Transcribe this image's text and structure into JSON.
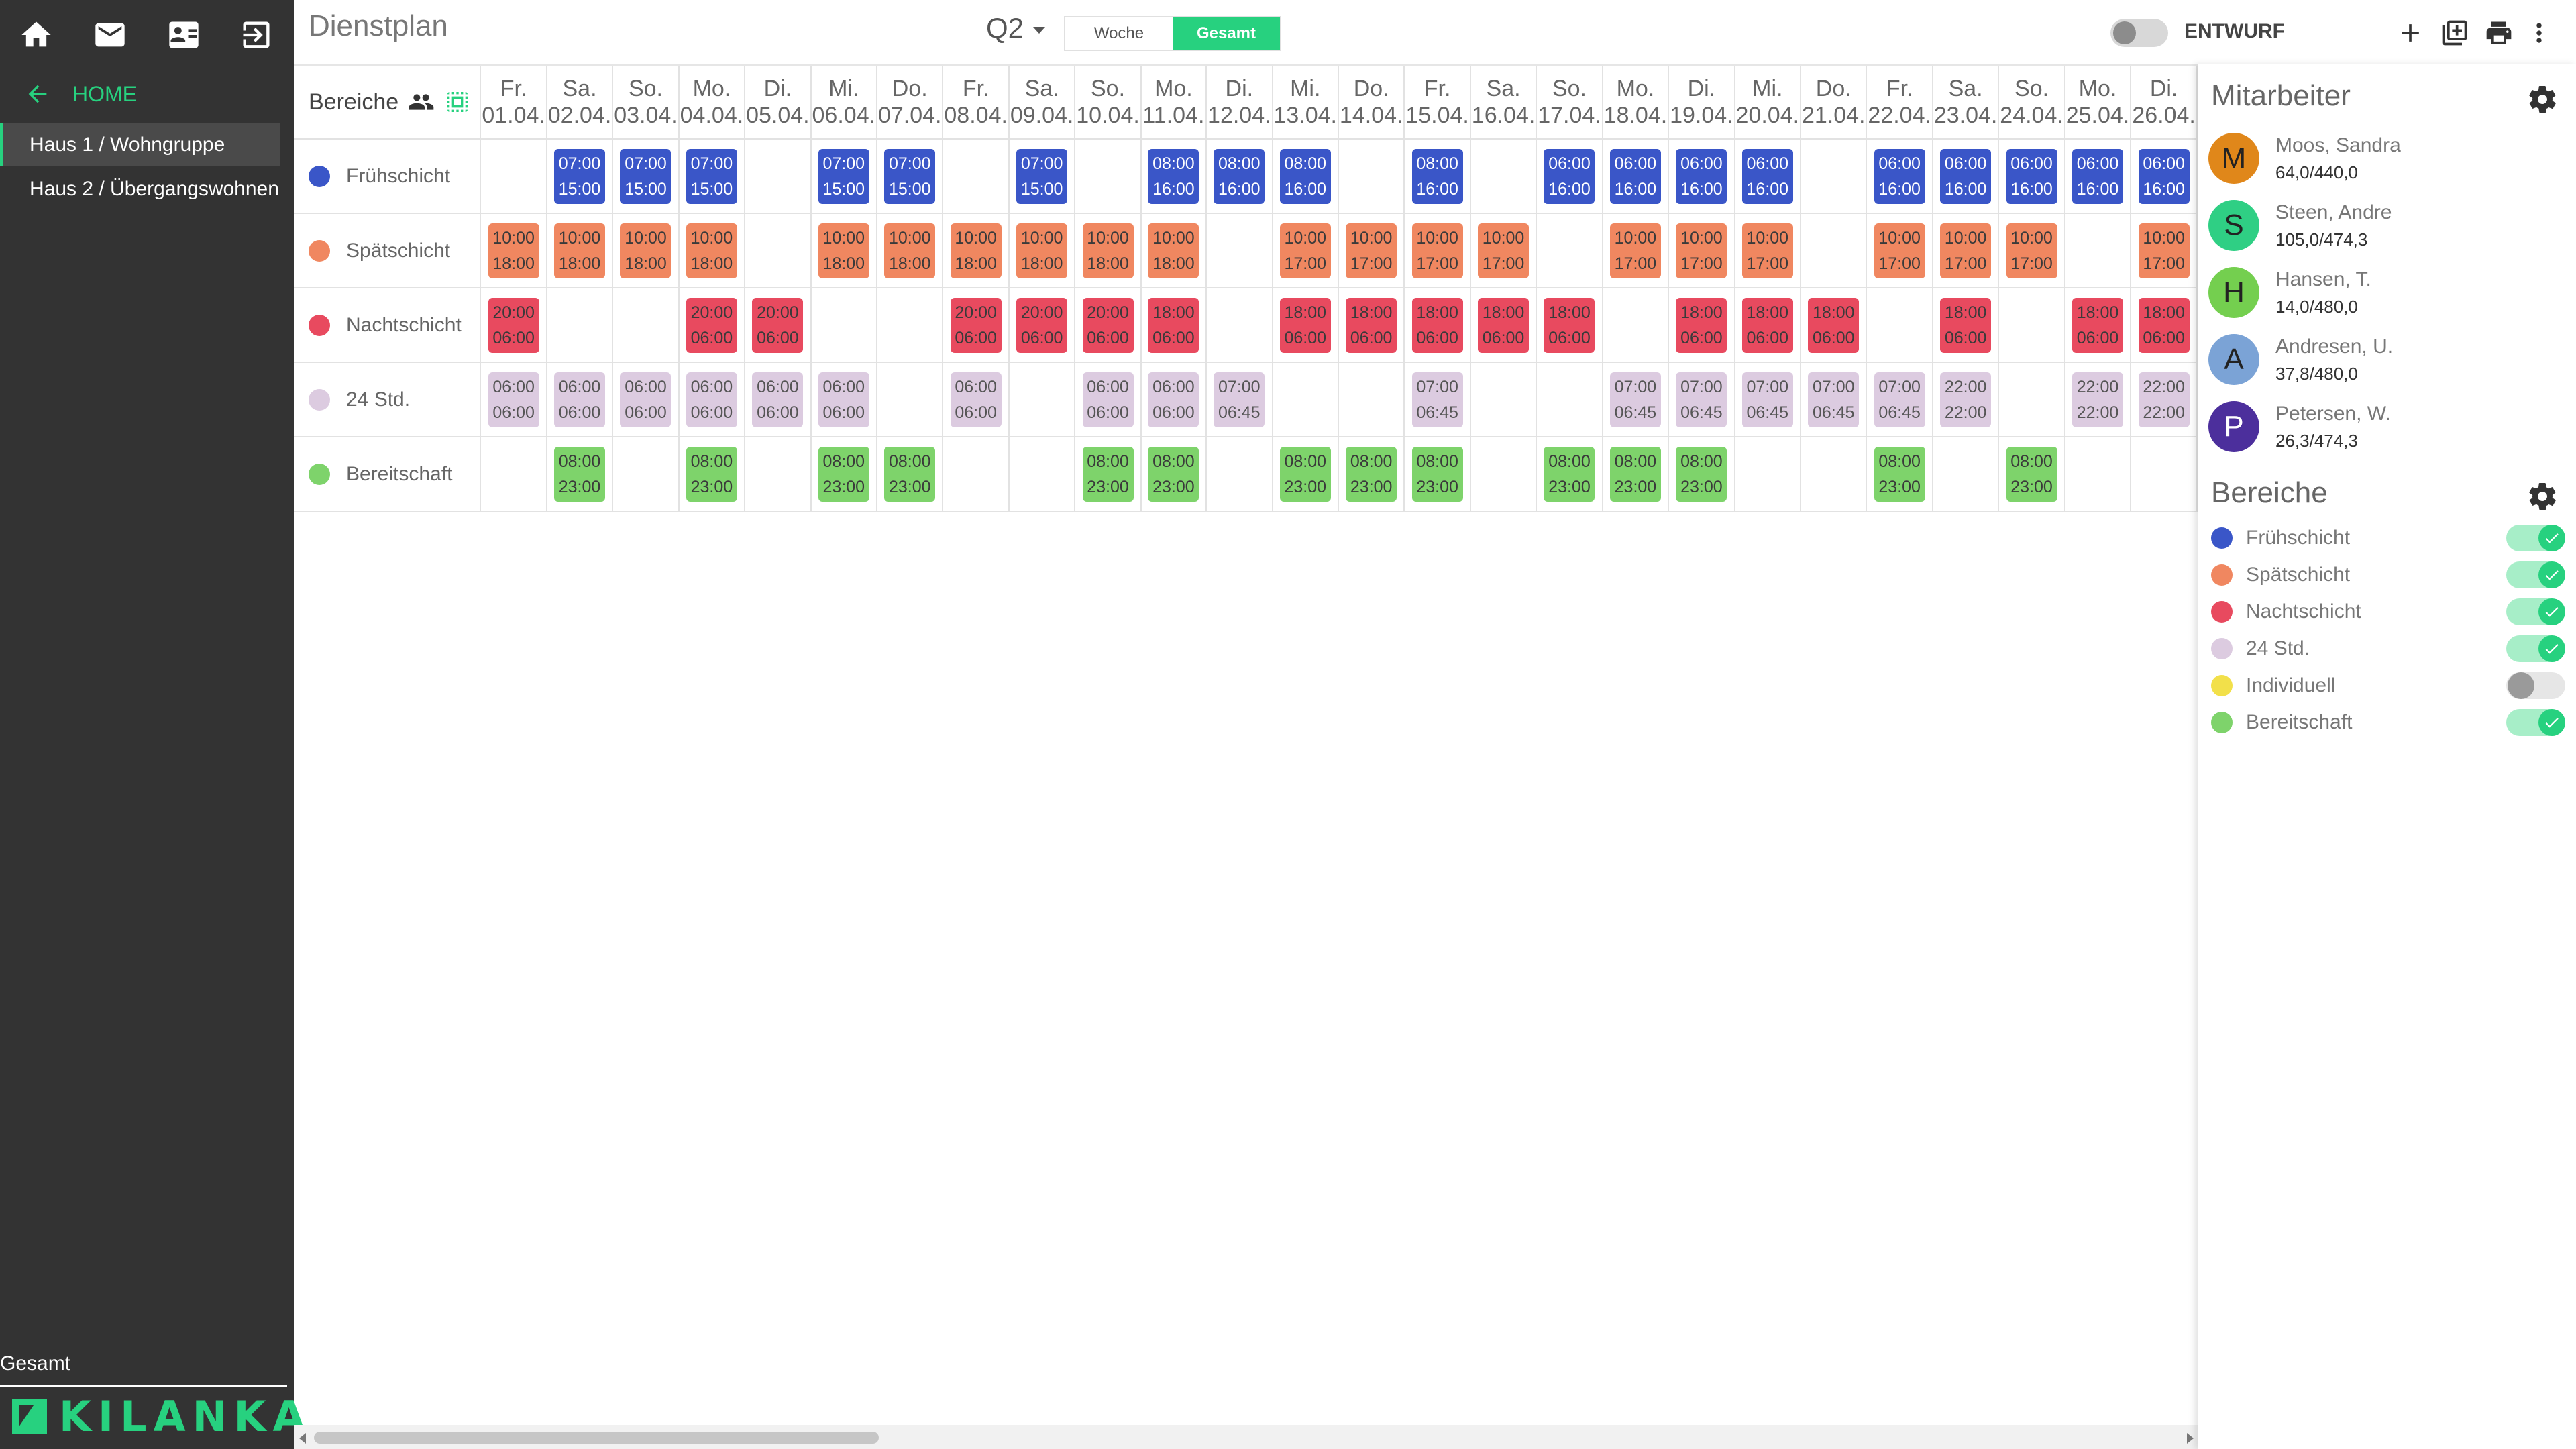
{
  "sidebar": {
    "home_label": "HOME",
    "nav": [
      "Haus 1 / Wohngruppe",
      "Haus 2 / Übergangswohnen"
    ],
    "footer_label": "Gesamt",
    "brand": "KILANKA"
  },
  "topbar": {
    "title": "Dienstplan",
    "quarter": "Q2",
    "view_week": "Woche",
    "view_all": "Gesamt",
    "draft_label": "ENTWURF"
  },
  "grid": {
    "corner_label": "Bereiche",
    "days": [
      [
        "Fr.",
        "01.04."
      ],
      [
        "Sa.",
        "02.04."
      ],
      [
        "So.",
        "03.04."
      ],
      [
        "Mo.",
        "04.04."
      ],
      [
        "Di.",
        "05.04."
      ],
      [
        "Mi.",
        "06.04."
      ],
      [
        "Do.",
        "07.04."
      ],
      [
        "Fr.",
        "08.04."
      ],
      [
        "Sa.",
        "09.04."
      ],
      [
        "So.",
        "10.04."
      ],
      [
        "Mo.",
        "11.04."
      ],
      [
        "Di.",
        "12.04."
      ],
      [
        "Mi.",
        "13.04."
      ],
      [
        "Do.",
        "14.04."
      ],
      [
        "Fr.",
        "15.04."
      ],
      [
        "Sa.",
        "16.04."
      ],
      [
        "So.",
        "17.04."
      ],
      [
        "Mo.",
        "18.04."
      ],
      [
        "Di.",
        "19.04."
      ],
      [
        "Mi.",
        "20.04."
      ],
      [
        "Do.",
        "21.04."
      ],
      [
        "Fr.",
        "22.04."
      ],
      [
        "Sa.",
        "23.04."
      ],
      [
        "So.",
        "24.04."
      ],
      [
        "Mo.",
        "25.04."
      ],
      [
        "Di.",
        "26.04."
      ]
    ],
    "rows": [
      {
        "name": "Frühschicht",
        "color": "#3a56c8",
        "bg": "#3a56c8",
        "fg": "#ffffff",
        "cells": [
          null,
          [
            "07:00",
            "15:00"
          ],
          [
            "07:00",
            "15:00"
          ],
          [
            "07:00",
            "15:00"
          ],
          null,
          [
            "07:00",
            "15:00"
          ],
          [
            "07:00",
            "15:00"
          ],
          null,
          [
            "07:00",
            "15:00"
          ],
          null,
          [
            "08:00",
            "16:00"
          ],
          [
            "08:00",
            "16:00"
          ],
          [
            "08:00",
            "16:00"
          ],
          null,
          [
            "08:00",
            "16:00"
          ],
          null,
          [
            "06:00",
            "16:00"
          ],
          [
            "06:00",
            "16:00"
          ],
          [
            "06:00",
            "16:00"
          ],
          [
            "06:00",
            "16:00"
          ],
          null,
          [
            "06:00",
            "16:00"
          ],
          [
            "06:00",
            "16:00"
          ],
          [
            "06:00",
            "16:00"
          ],
          [
            "06:00",
            "16:00"
          ],
          [
            "06:00",
            "16:00"
          ]
        ]
      },
      {
        "name": "Spätschicht",
        "color": "#f08760",
        "bg": "#f08760",
        "fg": "#3a3a3a",
        "cells": [
          [
            "10:00",
            "18:00"
          ],
          [
            "10:00",
            "18:00"
          ],
          [
            "10:00",
            "18:00"
          ],
          [
            "10:00",
            "18:00"
          ],
          null,
          [
            "10:00",
            "18:00"
          ],
          [
            "10:00",
            "18:00"
          ],
          [
            "10:00",
            "18:00"
          ],
          [
            "10:00",
            "18:00"
          ],
          [
            "10:00",
            "18:00"
          ],
          [
            "10:00",
            "18:00"
          ],
          null,
          [
            "10:00",
            "17:00"
          ],
          [
            "10:00",
            "17:00"
          ],
          [
            "10:00",
            "17:00"
          ],
          [
            "10:00",
            "17:00"
          ],
          null,
          [
            "10:00",
            "17:00"
          ],
          [
            "10:00",
            "17:00"
          ],
          [
            "10:00",
            "17:00"
          ],
          null,
          [
            "10:00",
            "17:00"
          ],
          [
            "10:00",
            "17:00"
          ],
          [
            "10:00",
            "17:00"
          ],
          null,
          [
            "10:00",
            "17:00"
          ]
        ]
      },
      {
        "name": "Nachtschicht",
        "color": "#e84a5f",
        "bg": "#e84a5f",
        "fg": "#3a3a3a",
        "cells": [
          [
            "20:00",
            "06:00"
          ],
          null,
          null,
          [
            "20:00",
            "06:00"
          ],
          [
            "20:00",
            "06:00"
          ],
          null,
          null,
          [
            "20:00",
            "06:00"
          ],
          [
            "20:00",
            "06:00"
          ],
          [
            "20:00",
            "06:00"
          ],
          [
            "18:00",
            "06:00"
          ],
          null,
          [
            "18:00",
            "06:00"
          ],
          [
            "18:00",
            "06:00"
          ],
          [
            "18:00",
            "06:00"
          ],
          [
            "18:00",
            "06:00"
          ],
          [
            "18:00",
            "06:00"
          ],
          null,
          [
            "18:00",
            "06:00"
          ],
          [
            "18:00",
            "06:00"
          ],
          [
            "18:00",
            "06:00"
          ],
          null,
          [
            "18:00",
            "06:00"
          ],
          null,
          [
            "18:00",
            "06:00"
          ],
          [
            "18:00",
            "06:00"
          ]
        ]
      },
      {
        "name": "24 Std.",
        "color": "#dccbe0",
        "bg": "#dccbe0",
        "fg": "#555555",
        "cells": [
          [
            "06:00",
            "06:00"
          ],
          [
            "06:00",
            "06:00"
          ],
          [
            "06:00",
            "06:00"
          ],
          [
            "06:00",
            "06:00"
          ],
          [
            "06:00",
            "06:00"
          ],
          [
            "06:00",
            "06:00"
          ],
          null,
          [
            "06:00",
            "06:00"
          ],
          null,
          [
            "06:00",
            "06:00"
          ],
          [
            "06:00",
            "06:00"
          ],
          [
            "07:00",
            "06:45"
          ],
          null,
          null,
          [
            "07:00",
            "06:45"
          ],
          null,
          null,
          [
            "07:00",
            "06:45"
          ],
          [
            "07:00",
            "06:45"
          ],
          [
            "07:00",
            "06:45"
          ],
          [
            "07:00",
            "06:45"
          ],
          [
            "07:00",
            "06:45"
          ],
          [
            "22:00",
            "22:00"
          ],
          null,
          [
            "22:00",
            "22:00"
          ],
          [
            "22:00",
            "22:00"
          ]
        ]
      },
      {
        "name": "Bereitschaft",
        "color": "#7ed36b",
        "bg": "#7ed36b",
        "fg": "#3a3a3a",
        "cells": [
          null,
          [
            "08:00",
            "23:00"
          ],
          null,
          [
            "08:00",
            "23:00"
          ],
          null,
          [
            "08:00",
            "23:00"
          ],
          [
            "08:00",
            "23:00"
          ],
          null,
          null,
          [
            "08:00",
            "23:00"
          ],
          [
            "08:00",
            "23:00"
          ],
          null,
          [
            "08:00",
            "23:00"
          ],
          [
            "08:00",
            "23:00"
          ],
          [
            "08:00",
            "23:00"
          ],
          null,
          [
            "08:00",
            "23:00"
          ],
          [
            "08:00",
            "23:00"
          ],
          [
            "08:00",
            "23:00"
          ],
          null,
          null,
          [
            "08:00",
            "23:00"
          ],
          null,
          [
            "08:00",
            "23:00"
          ],
          null,
          null
        ]
      }
    ]
  },
  "right_panel": {
    "employees_title": "Mitarbeiter",
    "employees": [
      {
        "initial": "M",
        "name": "Moos, Sandra",
        "hours": "64,0/440,0",
        "color": "#e0871a"
      },
      {
        "initial": "S",
        "name": "Steen, Andre",
        "hours": "105,0/474,3",
        "color": "#2fcf84"
      },
      {
        "initial": "H",
        "name": "Hansen, T.",
        "hours": "14,0/480,0",
        "color": "#74cf4f"
      },
      {
        "initial": "A",
        "name": "Andresen, U.",
        "hours": "37,8/480,0",
        "color": "#7ba3d6"
      },
      {
        "initial": "P",
        "name": "Petersen, W.",
        "hours": "26,3/474,3",
        "color": "#4c2f9c"
      }
    ],
    "areas_title": "Bereiche",
    "areas": [
      {
        "name": "Frühschicht",
        "color": "#3a56c8",
        "enabled": true
      },
      {
        "name": "Spätschicht",
        "color": "#f08760",
        "enabled": true
      },
      {
        "name": "Nachtschicht",
        "color": "#e84a5f",
        "enabled": true
      },
      {
        "name": "24 Std.",
        "color": "#dccbe0",
        "enabled": true
      },
      {
        "name": "Individuell",
        "color": "#f2e04a",
        "enabled": false
      },
      {
        "name": "Bereitschaft",
        "color": "#7ed36b",
        "enabled": true
      }
    ]
  },
  "icons": {
    "sidebar": [
      "home-icon",
      "mail-icon",
      "contact-card-icon",
      "logout-icon"
    ],
    "toolbar": [
      "plus-icon",
      "duplicate-icon",
      "print-icon",
      "more-vert-icon"
    ]
  }
}
